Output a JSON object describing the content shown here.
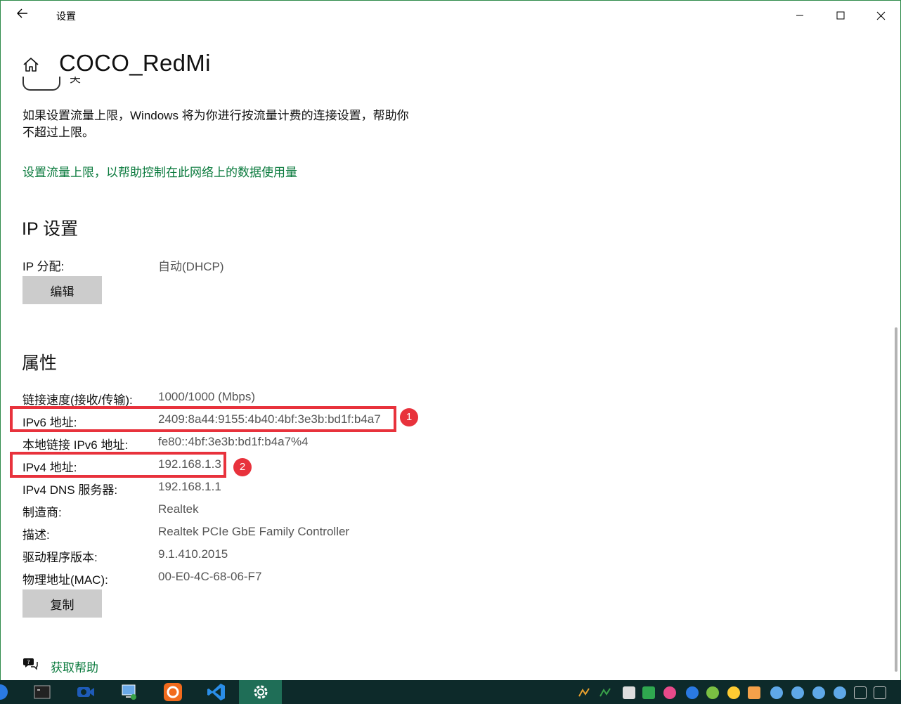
{
  "window": {
    "title": "设置",
    "back_icon": "back-arrow-icon",
    "minimize_icon": "minimize-icon",
    "maximize_icon": "maximize-icon",
    "close_icon": "close-icon"
  },
  "page": {
    "home_icon": "home-icon",
    "title": "COCO_RedMi",
    "partial_toggle_label": "关"
  },
  "metered": {
    "description": "如果设置流量上限，Windows 将为你进行按流量计费的连接设置，帮助你不超过上限。",
    "link": "设置流量上限，以帮助控制在此网络上的数据使用量"
  },
  "ip_settings": {
    "title": "IP 设置",
    "assignment_label": "IP 分配:",
    "assignment_value": "自动(DHCP)",
    "edit_button": "编辑"
  },
  "properties": {
    "title": "属性",
    "rows": [
      {
        "label": "链接速度(接收/传输):",
        "value": "1000/1000 (Mbps)"
      },
      {
        "label": "IPv6 地址:",
        "value": "2409:8a44:9155:4b40:4bf:3e3b:bd1f:b4a7"
      },
      {
        "label": "本地链接 IPv6 地址:",
        "value": "fe80::4bf:3e3b:bd1f:b4a7%4"
      },
      {
        "label": "IPv4 地址:",
        "value": "192.168.1.3"
      },
      {
        "label": "IPv4 DNS 服务器:",
        "value": "192.168.1.1"
      },
      {
        "label": "制造商:",
        "value": "Realtek"
      },
      {
        "label": "描述:",
        "value": "Realtek PCIe GbE Family Controller"
      },
      {
        "label": "驱动程序版本:",
        "value": "9.1.410.2015"
      },
      {
        "label": "物理地址(MAC):",
        "value": "00-E0-4C-68-06-F7"
      }
    ],
    "copy_button": "复制"
  },
  "annotations": {
    "badge_1": "1",
    "badge_2": "2",
    "color": "#e8323c"
  },
  "help": {
    "icon": "help-chat-icon",
    "label": "获取帮助"
  },
  "colors": {
    "accent_link": "#0a7a3d",
    "button_bg": "#cccccc",
    "taskbar": "#0d2a2a",
    "taskbar_active": "#1f6e57"
  },
  "taskbar": {
    "apps": [
      "terminal-icon",
      "video-camera-icon",
      "network-tool-icon",
      "orange-app-icon",
      "vscode-icon",
      "settings-gear-icon"
    ],
    "tray_icons": [
      "tray-icon",
      "tray-icon",
      "tray-icon",
      "tray-icon",
      "tray-icon",
      "tray-icon",
      "tray-icon",
      "tray-icon",
      "tray-icon",
      "tray-icon",
      "tray-icon",
      "tray-icon",
      "tray-icon",
      "tray-icon",
      "tray-icon"
    ]
  }
}
